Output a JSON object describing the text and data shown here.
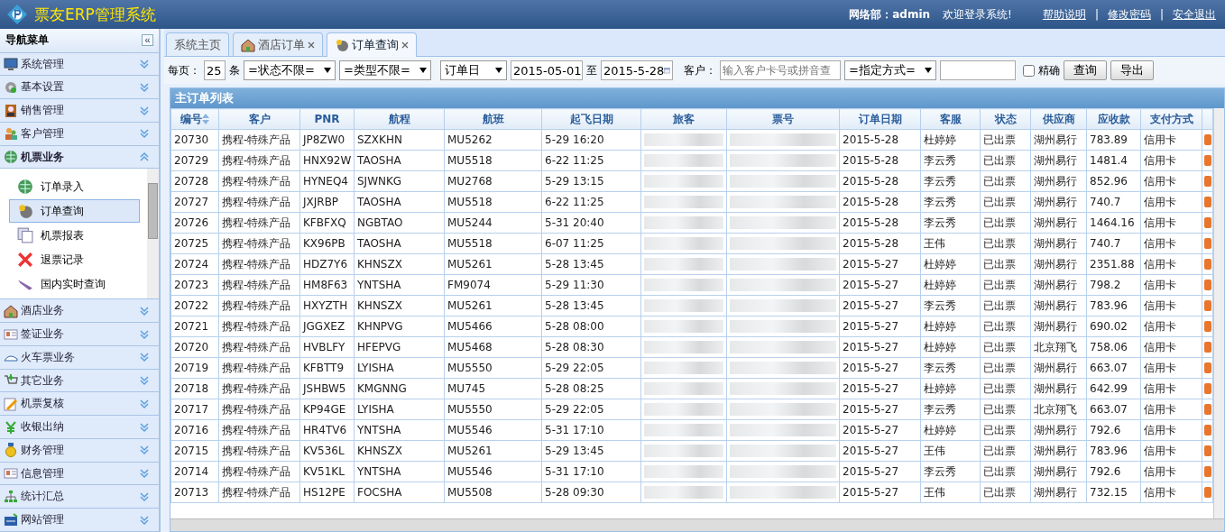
{
  "header": {
    "title": "票友ERP管理系统",
    "user": "网络部：admin",
    "welcome": "欢迎登录系统!",
    "links": [
      {
        "label": "帮助说明"
      },
      {
        "label": "修改密码"
      },
      {
        "label": "安全退出"
      }
    ],
    "separators": [
      "|",
      "|"
    ]
  },
  "sidebar": {
    "title": "导航菜单",
    "collapse": "«",
    "sections": [
      {
        "label": "系统管理",
        "expanded": false
      },
      {
        "label": "基本设置",
        "expanded": false
      },
      {
        "label": "销售管理",
        "expanded": false
      },
      {
        "label": "客户管理",
        "expanded": false
      },
      {
        "label": "机票业务",
        "expanded": true,
        "items": [
          {
            "label": "订单录入",
            "selected": false
          },
          {
            "label": "订单查询",
            "selected": true
          },
          {
            "label": "机票报表",
            "selected": false
          },
          {
            "label": "退票记录",
            "selected": false
          },
          {
            "label": "国内实时查询",
            "selected": false
          }
        ]
      },
      {
        "label": "酒店业务",
        "expanded": false
      },
      {
        "label": "签证业务",
        "expanded": false
      },
      {
        "label": "火车票业务",
        "expanded": false
      },
      {
        "label": "其它业务",
        "expanded": false
      },
      {
        "label": "机票复核",
        "expanded": false
      },
      {
        "label": "收银出纳",
        "expanded": false
      },
      {
        "label": "财务管理",
        "expanded": false
      },
      {
        "label": "信息管理",
        "expanded": false
      },
      {
        "label": "统计汇总",
        "expanded": false
      },
      {
        "label": "网站管理",
        "expanded": false
      }
    ]
  },
  "tabs": [
    {
      "label": "系统主页",
      "selected": false,
      "closable": false
    },
    {
      "label": "酒店订单",
      "selected": false,
      "closable": true
    },
    {
      "label": "订单查询",
      "selected": true,
      "closable": true
    }
  ],
  "toolbar": {
    "page_size_label": "每页：",
    "page_size": "25",
    "page_size_unit": "条",
    "status_select": "=状态不限=",
    "type_select": "=类型不限=",
    "date_type_select": "订单日",
    "date_from": "2015-05-01",
    "to_label": "至",
    "date_to": "2015-5-28",
    "customer_label": "客户：",
    "customer_placeholder": "输入客户卡号或拼音查",
    "method_select": "=指定方式=",
    "exact_label": "精确",
    "exact_checked": false,
    "buttons": [
      "查询",
      "导出"
    ]
  },
  "table": {
    "title": "主订单列表",
    "columns": [
      {
        "label": "编号",
        "kind": "text",
        "sortable": true
      },
      {
        "label": "客户",
        "kind": "text"
      },
      {
        "label": "PNR",
        "kind": "text"
      },
      {
        "label": "航程",
        "kind": "text"
      },
      {
        "label": "航班",
        "kind": "text"
      },
      {
        "label": "起飞日期",
        "kind": "text"
      },
      {
        "label": "旅客",
        "kind": "blurred"
      },
      {
        "label": "票号",
        "kind": "blurred"
      },
      {
        "label": "订单日期",
        "kind": "text"
      },
      {
        "label": "客服",
        "kind": "text"
      },
      {
        "label": "状态",
        "kind": "text"
      },
      {
        "label": "供应商",
        "kind": "text"
      },
      {
        "label": "应收款",
        "kind": "text"
      },
      {
        "label": "支付方式",
        "kind": "text"
      }
    ],
    "rows": [
      [
        "20730",
        "携程-特殊产品",
        "JP8ZW0",
        "SZXKHN",
        "MU5262",
        "5-29 16:20",
        "",
        "",
        "2015-5-28",
        "杜婷婷",
        "已出票",
        "湖州易行",
        "783.89",
        "信用卡"
      ],
      [
        "20729",
        "携程-特殊产品",
        "HNX92W",
        "TAOSHA",
        "MU5518",
        "6-22 11:25",
        "",
        "",
        "2015-5-28",
        "李云秀",
        "已出票",
        "湖州易行",
        "1481.4",
        "信用卡"
      ],
      [
        "20728",
        "携程-特殊产品",
        "HYNEQ4",
        "SJWNKG",
        "MU2768",
        "5-29 13:15",
        "",
        "",
        "2015-5-28",
        "李云秀",
        "已出票",
        "湖州易行",
        "852.96",
        "信用卡"
      ],
      [
        "20727",
        "携程-特殊产品",
        "JXJRBP",
        "TAOSHA",
        "MU5518",
        "6-22 11:25",
        "",
        "",
        "2015-5-28",
        "李云秀",
        "已出票",
        "湖州易行",
        "740.7",
        "信用卡"
      ],
      [
        "20726",
        "携程-特殊产品",
        "KFBFXQ",
        "NGBTAO",
        "MU5244",
        "5-31 20:40",
        "",
        "",
        "2015-5-28",
        "李云秀",
        "已出票",
        "湖州易行",
        "1464.16",
        "信用卡"
      ],
      [
        "20725",
        "携程-特殊产品",
        "KX96PB",
        "TAOSHA",
        "MU5518",
        "6-07 11:25",
        "",
        "",
        "2015-5-28",
        "王伟",
        "已出票",
        "湖州易行",
        "740.7",
        "信用卡"
      ],
      [
        "20724",
        "携程-特殊产品",
        "HDZ7Y6",
        "KHNSZX",
        "MU5261",
        "5-28 13:45",
        "",
        "",
        "2015-5-27",
        "杜婷婷",
        "已出票",
        "湖州易行",
        "2351.88",
        "信用卡"
      ],
      [
        "20723",
        "携程-特殊产品",
        "HM8F63",
        "YNTSHA",
        "FM9074",
        "5-29 11:30",
        "",
        "",
        "2015-5-27",
        "杜婷婷",
        "已出票",
        "湖州易行",
        "798.2",
        "信用卡"
      ],
      [
        "20722",
        "携程-特殊产品",
        "HXYZTH",
        "KHNSZX",
        "MU5261",
        "5-28 13:45",
        "",
        "",
        "2015-5-27",
        "李云秀",
        "已出票",
        "湖州易行",
        "783.96",
        "信用卡"
      ],
      [
        "20721",
        "携程-特殊产品",
        "JGGXEZ",
        "KHNPVG",
        "MU5466",
        "5-28 08:00",
        "",
        "",
        "2015-5-27",
        "杜婷婷",
        "已出票",
        "湖州易行",
        "690.02",
        "信用卡"
      ],
      [
        "20720",
        "携程-特殊产品",
        "HVBLFY",
        "HFEPVG",
        "MU5468",
        "5-28 08:30",
        "",
        "",
        "2015-5-27",
        "杜婷婷",
        "已出票",
        "北京翔飞",
        "758.06",
        "信用卡"
      ],
      [
        "20719",
        "携程-特殊产品",
        "KFBTT9",
        "LYISHA",
        "MU5550",
        "5-29 22:05",
        "",
        "",
        "2015-5-27",
        "李云秀",
        "已出票",
        "湖州易行",
        "663.07",
        "信用卡"
      ],
      [
        "20718",
        "携程-特殊产品",
        "JSHBW5",
        "KMGNNG",
        "MU745",
        "5-28 08:25",
        "",
        "",
        "2015-5-27",
        "杜婷婷",
        "已出票",
        "湖州易行",
        "642.99",
        "信用卡"
      ],
      [
        "20717",
        "携程-特殊产品",
        "KP94GE",
        "LYISHA",
        "MU5550",
        "5-29 22:05",
        "",
        "",
        "2015-5-27",
        "李云秀",
        "已出票",
        "北京翔飞",
        "663.07",
        "信用卡"
      ],
      [
        "20716",
        "携程-特殊产品",
        "HR4TV6",
        "YNTSHA",
        "MU5546",
        "5-31 17:10",
        "",
        "",
        "2015-5-27",
        "杜婷婷",
        "已出票",
        "湖州易行",
        "792.6",
        "信用卡"
      ],
      [
        "20715",
        "携程-特殊产品",
        "KV536L",
        "KHNSZX",
        "MU5261",
        "5-29 13:45",
        "",
        "",
        "2015-5-27",
        "王伟",
        "已出票",
        "湖州易行",
        "783.96",
        "信用卡"
      ],
      [
        "20714",
        "携程-特殊产品",
        "KV51KL",
        "YNTSHA",
        "MU5546",
        "5-31 17:10",
        "",
        "",
        "2015-5-27",
        "李云秀",
        "已出票",
        "湖州易行",
        "792.6",
        "信用卡"
      ],
      [
        "20713",
        "携程-特殊产品",
        "HS12PE",
        "FOCSHA",
        "MU5508",
        "5-28 09:30",
        "",
        "",
        "2015-5-27",
        "王伟",
        "已出票",
        "湖州易行",
        "732.15",
        "信用卡"
      ]
    ]
  }
}
